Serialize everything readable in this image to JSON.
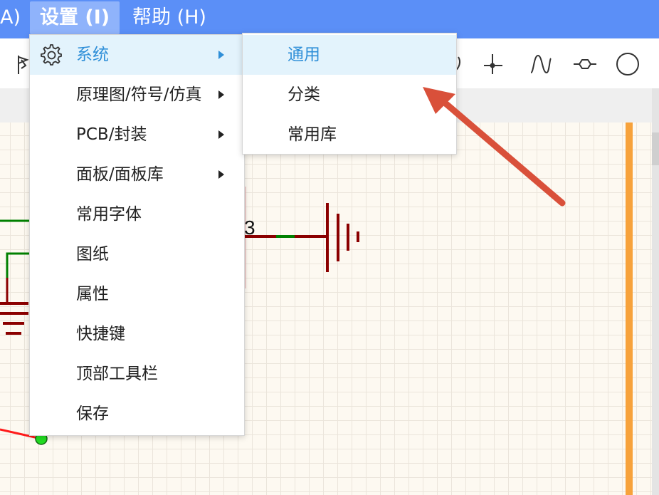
{
  "menubar": {
    "items": [
      {
        "label": "A)"
      },
      {
        "label": "设置 (I)"
      },
      {
        "label": "帮助 (H)"
      }
    ]
  },
  "settings_menu": {
    "items": [
      {
        "label": "系统"
      },
      {
        "label": "原理图/符号/仿真"
      },
      {
        "label": "PCB/封装"
      },
      {
        "label": "面板/面板库"
      },
      {
        "label": "常用字体"
      },
      {
        "label": "图纸"
      },
      {
        "label": "属性"
      },
      {
        "label": "快捷键"
      },
      {
        "label": "顶部工具栏"
      },
      {
        "label": "保存"
      }
    ]
  },
  "system_submenu": {
    "items": [
      {
        "label": "通用"
      },
      {
        "label": "分类"
      },
      {
        "label": "常用库"
      }
    ]
  },
  "canvas": {
    "pin_number": "3"
  },
  "colors": {
    "menubar_bg": "#5b8ff7",
    "highlight_bg": "#e3f3fc",
    "highlight_text": "#2f8fd8",
    "wire_green": "#008000",
    "symbol_darkred": "#8b0000",
    "annotation_arrow": "#d9503a",
    "border_orange": "#f7a23b"
  }
}
